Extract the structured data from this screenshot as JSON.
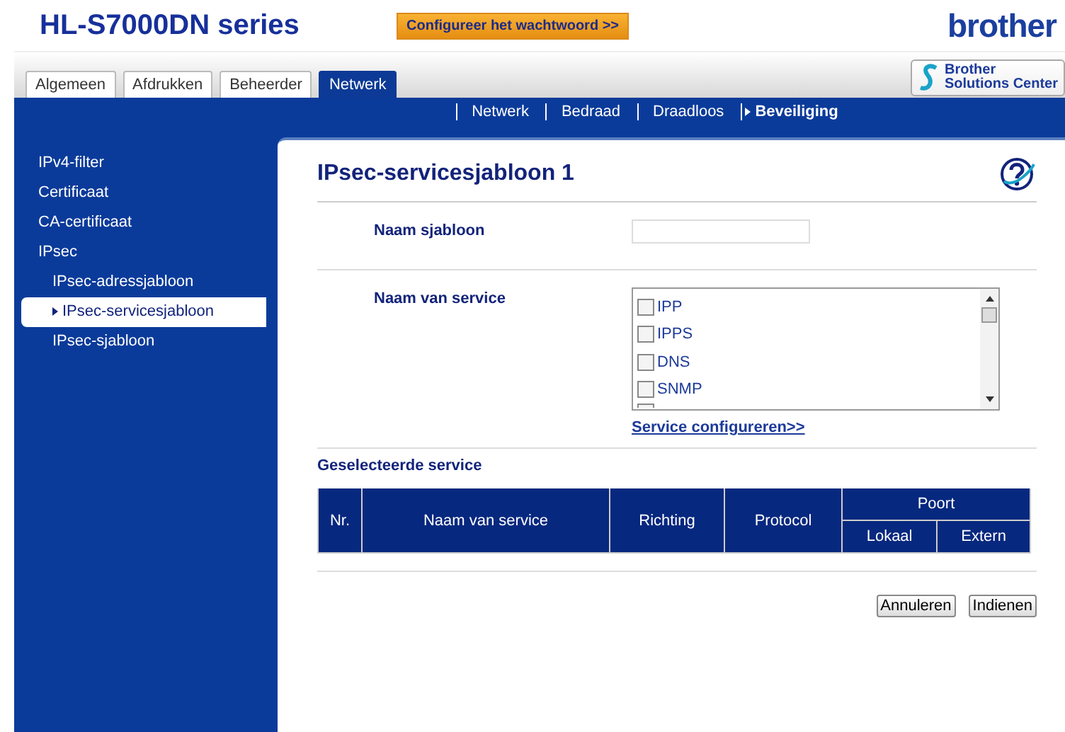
{
  "header": {
    "title": "HL-S7000DN series",
    "password_button": "Configureer het wachtwoord >>",
    "logo": "brother",
    "solutions_button": [
      "Brother",
      "Solutions Center"
    ]
  },
  "tabs": [
    {
      "label": "Algemeen",
      "selected": false
    },
    {
      "label": "Afdrukken",
      "selected": false
    },
    {
      "label": "Beheerder",
      "selected": false
    },
    {
      "label": "Netwerk",
      "selected": true
    }
  ],
  "subnav": [
    {
      "label": "Netwerk",
      "selected": false
    },
    {
      "label": "Bedraad",
      "selected": false
    },
    {
      "label": "Draadloos",
      "selected": false
    },
    {
      "label": "Beveiliging",
      "selected": true
    }
  ],
  "sidebar": {
    "items": [
      {
        "label": "IPv4-filter",
        "selected": false
      },
      {
        "label": "Certificaat",
        "selected": false
      },
      {
        "label": "CA-certificaat",
        "selected": false
      },
      {
        "label": "IPsec",
        "selected": false,
        "children": [
          {
            "label": "IPsec-adressjabloon",
            "selected": false
          },
          {
            "label": "IPsec-servicesjabloon",
            "selected": true
          },
          {
            "label": "IPsec-sjabloon",
            "selected": false
          }
        ]
      }
    ]
  },
  "content": {
    "title": "IPsec-servicesjabloon 1",
    "template_name": {
      "label": "Naam sjabloon"
    },
    "service_name": {
      "label": "Naam van service",
      "options": [
        {
          "label": "IPP",
          "checked": false
        },
        {
          "label": "IPPS",
          "checked": false
        },
        {
          "label": "DNS",
          "checked": false
        },
        {
          "label": "SNMP",
          "checked": false
        }
      ],
      "link": "Service configureren>>"
    },
    "selected_service": {
      "title": "Geselecteerde service",
      "columns": [
        "Nr.",
        "Naam van service",
        "Richting",
        "Protocol"
      ],
      "group": "Poort",
      "subcolumns": [
        "Lokaal",
        "Extern"
      ]
    },
    "buttons": [
      "Annuleren",
      "Indienen"
    ]
  }
}
